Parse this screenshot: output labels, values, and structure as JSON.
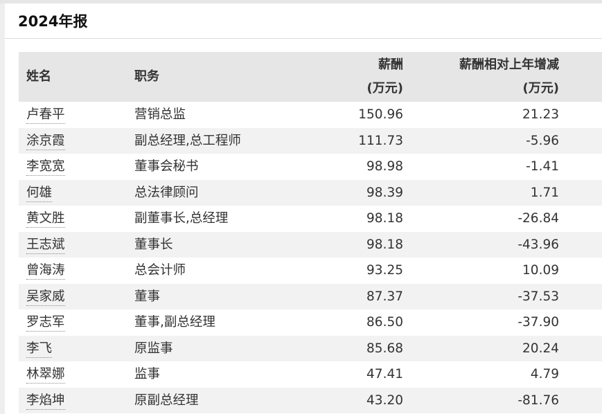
{
  "report": {
    "title": "2024年报"
  },
  "table": {
    "headers": {
      "name": "姓名",
      "position": "职务",
      "pay_line1": "薪酬",
      "pay_line2": "(万元)",
      "change_line1": "薪酬相对上年增减",
      "change_line2": "(万元)"
    },
    "rows": [
      {
        "name": "卢春平",
        "position": "营销总监",
        "pay": "150.96",
        "change": "21.23"
      },
      {
        "name": "涂京霞",
        "position": "副总经理,总工程师",
        "pay": "111.73",
        "change": "-5.96"
      },
      {
        "name": "李宽宽",
        "position": "董事会秘书",
        "pay": "98.98",
        "change": "-1.41"
      },
      {
        "name": "何雄",
        "position": "总法律顾问",
        "pay": "98.39",
        "change": "1.71"
      },
      {
        "name": "黄文胜",
        "position": "副董事长,总经理",
        "pay": "98.18",
        "change": "-26.84"
      },
      {
        "name": "王志斌",
        "position": "董事长",
        "pay": "98.18",
        "change": "-43.96"
      },
      {
        "name": "曾海涛",
        "position": "总会计师",
        "pay": "93.25",
        "change": "10.09"
      },
      {
        "name": "吴家威",
        "position": "董事",
        "pay": "87.37",
        "change": "-37.53"
      },
      {
        "name": "罗志军",
        "position": "董事,副总经理",
        "pay": "86.50",
        "change": "-37.90"
      },
      {
        "name": "李飞",
        "position": "原监事",
        "pay": "85.68",
        "change": "20.24"
      },
      {
        "name": "林翠娜",
        "position": "监事",
        "pay": "47.41",
        "change": "4.79"
      },
      {
        "name": "李焰坤",
        "position": "原副总经理",
        "pay": "43.20",
        "change": "-81.76"
      }
    ]
  }
}
